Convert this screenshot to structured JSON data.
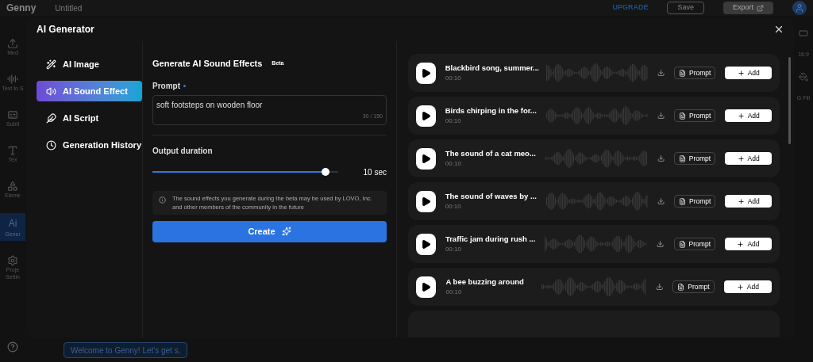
{
  "app_bar": {
    "logo": "Genny",
    "project": "Untitled",
    "upgrade": "UPGRADE",
    "save": "Save",
    "export": "Export"
  },
  "side_tools": [
    {
      "label": "Med",
      "selected": false
    },
    {
      "label": "Text to S",
      "selected": false
    },
    {
      "label": "Subti",
      "selected": false
    },
    {
      "label": "Tex",
      "selected": false
    },
    {
      "label": "Eleme",
      "selected": false
    },
    {
      "label": "Gener",
      "selected": true,
      "icon_text": "Ai"
    },
    {
      "label": "Proje Settin",
      "selected": false
    }
  ],
  "right_tools": [
    "16:9",
    "G Fill"
  ],
  "timeline": {
    "caption": "Welcome to Genny! Let's get s."
  },
  "dialog": {
    "title": "AI Generator",
    "nav": [
      {
        "label": "AI Image",
        "selected": false
      },
      {
        "label": "AI Sound Effect",
        "selected": true
      },
      {
        "label": "AI Script",
        "selected": false
      },
      {
        "label": "Generation History",
        "selected": false
      }
    ],
    "panel": {
      "title": "Generate AI Sound Effects",
      "badge": "Beta",
      "prompt_label": "Prompt",
      "prompt_required": true,
      "prompt": {
        "value": "soft footsteps on wooden floor",
        "counter": "30 / 150"
      },
      "duration_label": "Output duration",
      "duration": {
        "level": 0.93,
        "reading": "10 sec"
      },
      "notice": "The sound effects you generate during the beta may be used by LOVO, Inc. and other members of the community in the future",
      "create": "Create"
    },
    "results": [
      {
        "title": "Blackbird song, summer...",
        "duration": "00:10",
        "prompt_button": "Prompt",
        "add_button": "Add"
      },
      {
        "title": "Birds chirping in the for...",
        "duration": "00:10",
        "prompt_button": "Prompt",
        "add_button": "Add"
      },
      {
        "title": "The sound of a cat meo...",
        "duration": "00:10",
        "prompt_button": "Prompt",
        "add_button": "Add"
      },
      {
        "title": "The sound of waves by ...",
        "duration": "00:10",
        "prompt_button": "Prompt",
        "add_button": "Add"
      },
      {
        "title": "Traffic jam during rush ...",
        "duration": "00:10",
        "prompt_button": "Prompt",
        "add_button": "Add"
      },
      {
        "title": "A bee buzzing around",
        "duration": "00:10",
        "prompt_button": "Prompt",
        "add_button": "Add"
      }
    ]
  }
}
